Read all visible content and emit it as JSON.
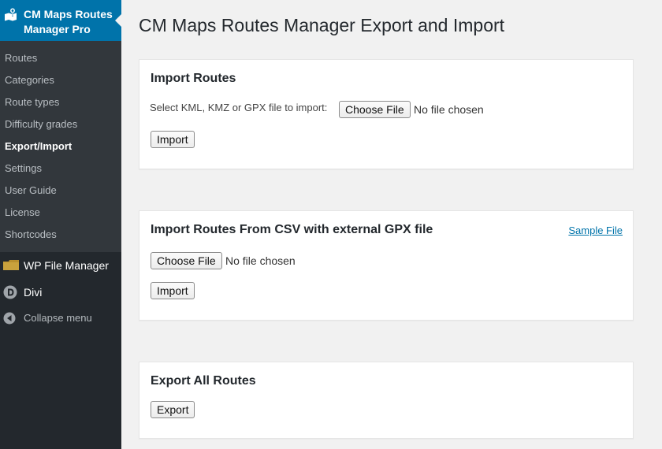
{
  "sidebar": {
    "plugin_title": "CM Maps Routes Manager Pro",
    "plugin_icon": "map-pin-icon",
    "submenu": [
      {
        "label": "Routes",
        "current": false
      },
      {
        "label": "Categories",
        "current": false
      },
      {
        "label": "Route types",
        "current": false
      },
      {
        "label": "Difficulty grades",
        "current": false
      },
      {
        "label": "Export/Import",
        "current": true
      },
      {
        "label": "Settings",
        "current": false
      },
      {
        "label": "User Guide",
        "current": false
      },
      {
        "label": "License",
        "current": false
      },
      {
        "label": "Shortcodes",
        "current": false
      }
    ],
    "menu_items": [
      {
        "label": "WP File Manager",
        "icon": "folder-icon"
      },
      {
        "label": "Divi",
        "icon": "divi-icon"
      },
      {
        "label": "Collapse menu",
        "icon": "collapse-arrow-icon"
      }
    ]
  },
  "page": {
    "title": "CM Maps Routes Manager Export and Import"
  },
  "import_routes": {
    "heading": "Import Routes",
    "field_label": "Select KML, KMZ or GPX file to import:",
    "choose_file_label": "Choose File",
    "no_file_text": "No file chosen",
    "import_label": "Import"
  },
  "import_csv": {
    "heading": "Import Routes From CSV with external GPX file",
    "sample_link": "Sample File",
    "choose_file_label": "Choose File",
    "no_file_text": "No file chosen",
    "import_label": "Import"
  },
  "export_routes": {
    "heading": "Export All Routes",
    "export_label": "Export"
  },
  "colors": {
    "accent": "#0073aa",
    "sidebar_bg": "#23282d",
    "submenu_bg": "#32373c",
    "page_bg": "#f1f1f1",
    "link": "#0073aa"
  }
}
